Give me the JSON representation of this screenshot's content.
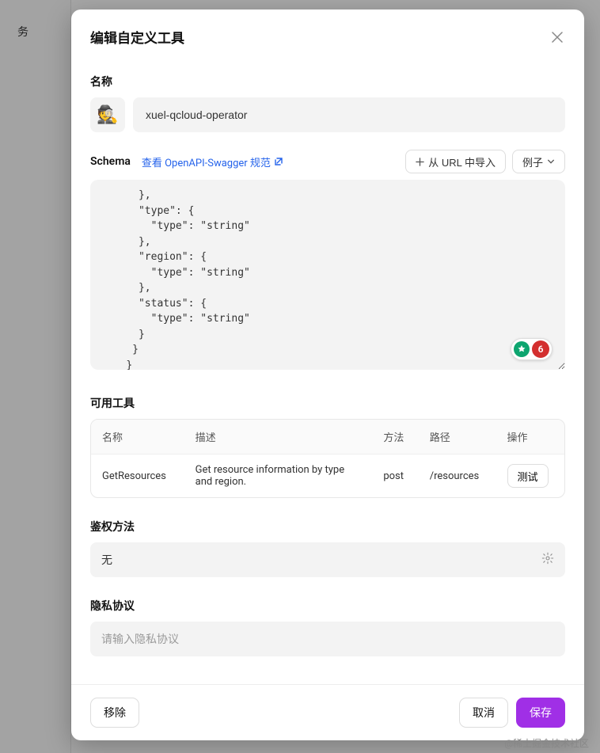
{
  "backdrop": {
    "tab": "务"
  },
  "modal": {
    "title": "编辑自定义工具",
    "name_label": "名称",
    "icon_emoji": "🕵️",
    "name_value": "xuel-qcloud-operator",
    "schema": {
      "title": "Schema",
      "swagger_link": "查看 OpenAPI-Swagger 规范",
      "import_url_btn": "从 URL 中导入",
      "example_btn": "例子",
      "content": "      },\n      \"type\": {\n        \"type\": \"string\"\n      },\n      \"region\": {\n        \"type\": \"string\"\n      },\n      \"status\": {\n        \"type\": \"string\"\n      }\n     }\n    }\n   }\n  }\n }\n}",
      "grammar_count": "6"
    },
    "tools": {
      "label": "可用工具",
      "columns": {
        "name": "名称",
        "desc": "描述",
        "method": "方法",
        "path": "路径",
        "action": "操作"
      },
      "rows": [
        {
          "name": "GetResources",
          "desc": "Get resource information by type and region.",
          "method": "post",
          "path": "/resources",
          "action": "测试"
        }
      ]
    },
    "auth": {
      "label": "鉴权方法",
      "value": "无"
    },
    "privacy": {
      "label": "隐私协议",
      "placeholder": "请输入隐私协议"
    },
    "footer": {
      "remove": "移除",
      "cancel": "取消",
      "save": "保存"
    }
  },
  "watermark": "@稀土掘金技术社区"
}
